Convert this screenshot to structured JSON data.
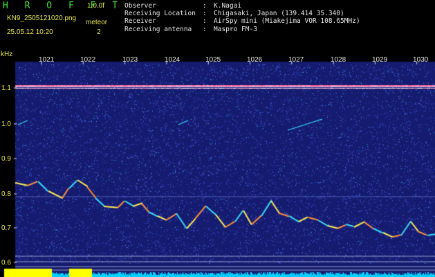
{
  "header": {
    "app_title": "H R O F F T",
    "version": "1.0.0f",
    "file_name": "KN9_2505121020.png",
    "meteor_label": "meteor",
    "meteor_count": "2",
    "datetime": "25.05.12 10:20",
    "info": [
      {
        "key": "Observer",
        "value": "K.Nagai"
      },
      {
        "key": "Receiving Location",
        "value": "Chigasaki, Japan (139.414 35.340)"
      },
      {
        "key": "Receiver",
        "value": "AirSpy mini (Miakejima VOR 108.65MHz)"
      },
      {
        "key": "Receiving antenna",
        "value": "Maspro FM-3"
      }
    ]
  },
  "spectrogram": {
    "unit_label": "kHz",
    "y_ticks": [
      "1.1",
      "1.0",
      "0.9",
      "0.8",
      "0.7",
      "0.6"
    ],
    "x_ticks": [
      "1021",
      "1022",
      "1023",
      "1024",
      "1025",
      "1026",
      "1027",
      "1028",
      "1029",
      "1030"
    ],
    "colors": {
      "background": "#151b6e",
      "noise": "#4a63ff",
      "carrier": "#ff8fc0",
      "trace": "#ffee55",
      "bar_yellow": "#ffff00",
      "bar_cyan": "#00d0ff",
      "text_yellow": "#e8e84a"
    }
  }
}
